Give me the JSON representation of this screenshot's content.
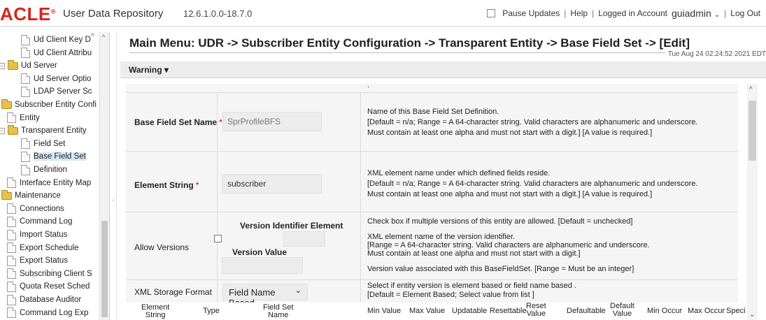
{
  "header": {
    "brand": "ACLE",
    "brand_mark": "®",
    "app_title": "User Data Repository",
    "version": "12.6.1.0.0-18.7.0",
    "pause_updates": "Pause Updates",
    "help": "Help",
    "logged_in_label": "Logged in Account",
    "user": "guiadmin",
    "logout": "Log Out",
    "separator": "|"
  },
  "sidebar": {
    "items": [
      {
        "label": "Ud Client Key D",
        "kind": "doc",
        "indent": 1
      },
      {
        "label": "Ud Client Attribu",
        "kind": "doc",
        "indent": 1
      },
      {
        "label": "Ud Server",
        "kind": "folder",
        "indent": 0,
        "toggle": "−"
      },
      {
        "label": "Ud Server Optio",
        "kind": "doc",
        "indent": 1
      },
      {
        "label": "LDAP Server Sc",
        "kind": "doc",
        "indent": 1
      },
      {
        "label": "Subscriber Entity Confi",
        "kind": "folder",
        "indent": -1
      },
      {
        "label": "Entity",
        "kind": "doc",
        "indent": 0
      },
      {
        "label": "Transparent Entity",
        "kind": "folder",
        "indent": 0,
        "toggle": "−"
      },
      {
        "label": "Field Set",
        "kind": "doc",
        "indent": 1
      },
      {
        "label": "Base Field Set",
        "kind": "doc",
        "indent": 1,
        "selected": true
      },
      {
        "label": "Definition",
        "kind": "doc",
        "indent": 1
      },
      {
        "label": "Interface Entity Map",
        "kind": "doc",
        "indent": 0
      },
      {
        "label": "Maintenance",
        "kind": "folder",
        "indent": -1
      },
      {
        "label": "Connections",
        "kind": "doc",
        "indent": 0
      },
      {
        "label": "Command Log",
        "kind": "doc",
        "indent": 0
      },
      {
        "label": "Import Status",
        "kind": "doc",
        "indent": 0
      },
      {
        "label": "Export Schedule",
        "kind": "doc",
        "indent": 0
      },
      {
        "label": "Export Status",
        "kind": "doc",
        "indent": 0
      },
      {
        "label": "Subscribing Client S",
        "kind": "doc",
        "indent": 0
      },
      {
        "label": "Quota Reset Sched",
        "kind": "doc",
        "indent": 0
      },
      {
        "label": "Database Auditor",
        "kind": "doc",
        "indent": 0
      },
      {
        "label": "Command Log Exp",
        "kind": "doc",
        "indent": 0
      }
    ]
  },
  "main": {
    "title": "Main Menu: UDR -> Subscriber Entity Configuration -> Transparent Entity -> Base Field Set -> [Edit]",
    "timestamp": "Tue Aug 24 02:24:52 2021 EDT",
    "warning_menu": "Warning",
    "fields": {
      "base_field_set_name": {
        "label": "Base Field Set Name",
        "required_mark": "*",
        "value": "SprProfileBFS",
        "desc": [
          "Name of this Base Field Set Definition.",
          "[Default = n/a; Range = A 64-character string. Valid characters are alphanumeric and underscore.",
          "Must contain at least one alpha and must not start with a digit.] [A value is required.]"
        ]
      },
      "element_string": {
        "label": "Element String",
        "required_mark": "*",
        "value": "subscriber",
        "desc": [
          "XML element name under which defined fields reside.",
          "[Default = n/a; Range = A 64-character string. Valid characters are alphanumeric and underscore.",
          "Must contain at least one alpha and must not start with a digit.] [A value is required.]"
        ]
      },
      "allow_versions": {
        "label": "Allow Versions",
        "checked": false,
        "version_identifier_label": "Version Identifier Element",
        "version_identifier_value": "",
        "version_value_label": "Version Value",
        "version_value_value": "",
        "desc_checkbox": "Check box if multiple versions of this entity are allowed. [Default = unchecked]",
        "desc_identifier": [
          "XML element name of the version identifier.",
          "[Range = A 64-character string. Valid characters are alphanumeric and underscore.",
          "Must contain at least one alpha and must not start with a digit.]"
        ],
        "desc_value": "Version value associated with this BaseFieldSet. [Range = Must be an integer]"
      },
      "xml_storage_format": {
        "label": "XML Storage Format",
        "value": "Field Name Based",
        "desc": [
          "Select if entity version is element based or field name based .",
          "[Default = Element Based; Select value from list ]"
        ]
      }
    },
    "table_headers": {
      "element_string": [
        "Element",
        "String"
      ],
      "type": "Type",
      "field_set_name": [
        "Field Set",
        "Name"
      ],
      "min_value": "Min Value",
      "max_value": "Max Value",
      "updatable": "Updatable",
      "resettable": "Resettable",
      "reset_value": [
        "Reset",
        "Value"
      ],
      "defaultable": "Defaultable",
      "default_value": [
        "Default",
        "Value"
      ],
      "min_occur": "Min Occur",
      "max_occur": "Max Occur",
      "special": "Speci"
    },
    "top_band_glyph": "."
  },
  "icons": {
    "chevron_down": "⌄",
    "caret_down": "▾",
    "scroll_up": "^",
    "scroll_down": "⌄",
    "collapse": "−",
    "splitter_handle": "·"
  },
  "colors": {
    "brand_red": "#d7261b",
    "required_red": "#cc0000",
    "folder_yellow": "#e8c14a",
    "selected_bg": "#d5e6f5"
  }
}
